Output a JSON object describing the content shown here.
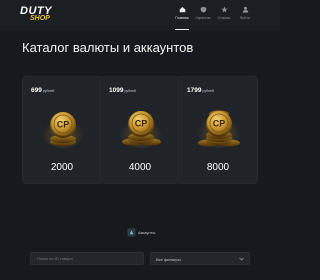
{
  "header": {
    "logo_main": "DUTY",
    "logo_sub": "SHOP",
    "nav": [
      {
        "label": "Главная",
        "icon": "home-icon",
        "active": true
      },
      {
        "label": "Гарантии",
        "icon": "shield-icon",
        "active": false
      },
      {
        "label": "Отзывы",
        "icon": "star-icon",
        "active": false
      },
      {
        "label": "Войти",
        "icon": "user-icon",
        "active": false
      }
    ]
  },
  "catalog": {
    "title": "Каталог валюты и аккаунтов",
    "cards": [
      {
        "price": "699",
        "currency": "рублей",
        "amount": "2000"
      },
      {
        "price": "1099",
        "currency": "рублей",
        "amount": "4000"
      },
      {
        "price": "1799",
        "currency": "рублей",
        "amount": "8000"
      }
    ]
  },
  "accounts": {
    "label": "Аккаунты"
  },
  "filters": {
    "search_placeholder": "Поиск по ID товара",
    "filter_label": "Все фильтры"
  },
  "colors": {
    "background": "#16191d",
    "card": "#202328",
    "coin_gold": "#c9962d",
    "accent_logo": "#e5c33b"
  }
}
